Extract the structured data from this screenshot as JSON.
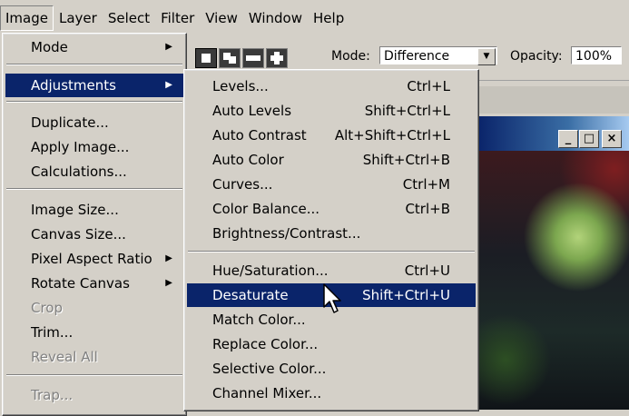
{
  "menubar": {
    "items": [
      "Image",
      "Layer",
      "Select",
      "Filter",
      "View",
      "Window",
      "Help"
    ]
  },
  "options_bar": {
    "mode_label": "Mode:",
    "mode_value": "Difference",
    "opacity_label": "Opacity:",
    "opacity_value": "100%"
  },
  "document_window": {
    "minimize": "_",
    "maximize": "□",
    "close": "×"
  },
  "image_menu": {
    "items": [
      {
        "label": "Mode",
        "submenu": true
      },
      {
        "label": "Adjustments",
        "submenu": true,
        "highlighted": true
      },
      {
        "label": "Duplicate..."
      },
      {
        "label": "Apply Image..."
      },
      {
        "label": "Calculations..."
      },
      {
        "label": "Image Size..."
      },
      {
        "label": "Canvas Size..."
      },
      {
        "label": "Pixel Aspect Ratio",
        "submenu": true
      },
      {
        "label": "Rotate Canvas",
        "submenu": true
      },
      {
        "label": "Crop",
        "disabled": true
      },
      {
        "label": "Trim..."
      },
      {
        "label": "Reveal All",
        "disabled": true
      },
      {
        "label": "Trap...",
        "disabled": true
      }
    ]
  },
  "adjustments_menu": {
    "items": [
      {
        "label": "Levels...",
        "shortcut": "Ctrl+L"
      },
      {
        "label": "Auto Levels",
        "shortcut": "Shift+Ctrl+L"
      },
      {
        "label": "Auto Contrast",
        "shortcut": "Alt+Shift+Ctrl+L"
      },
      {
        "label": "Auto Color",
        "shortcut": "Shift+Ctrl+B"
      },
      {
        "label": "Curves...",
        "shortcut": "Ctrl+M"
      },
      {
        "label": "Color Balance...",
        "shortcut": "Ctrl+B"
      },
      {
        "label": "Brightness/Contrast...",
        "shortcut": ""
      },
      {
        "label": "Hue/Saturation...",
        "shortcut": "Ctrl+U"
      },
      {
        "label": "Desaturate",
        "shortcut": "Shift+Ctrl+U",
        "highlighted": true
      },
      {
        "label": "Match Color...",
        "shortcut": ""
      },
      {
        "label": "Replace Color...",
        "shortcut": ""
      },
      {
        "label": "Selective Color...",
        "shortcut": ""
      },
      {
        "label": "Channel Mixer...",
        "shortcut": ""
      }
    ]
  },
  "icons": {
    "submenu_arrow": "triangle-right-icon",
    "dropdown_arrow": "chevron-down-icon",
    "cursor": "mouse-pointer-icon"
  },
  "colors": {
    "highlight": "#0a246a",
    "menu_bg": "#d4d0c8"
  }
}
